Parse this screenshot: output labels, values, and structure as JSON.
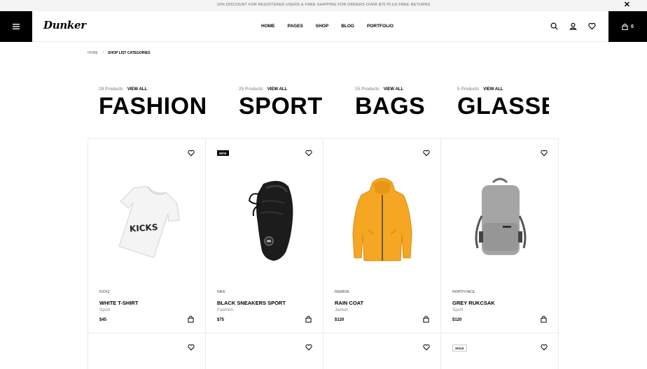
{
  "topbar": {
    "promo": "10% DISCOUNT FOR REGISTERED USERS & FREE SHIPPING FOR ORDERS OVER $70 PLUS FREE RETURNS",
    "close_icon": "close-icon"
  },
  "header": {
    "logo": "Dunker",
    "nav": [
      "HOME",
      "PAGES",
      "SHOP",
      "BLOG",
      "PORTFOLIO"
    ],
    "cart_count": "0",
    "icons": [
      "menu-icon",
      "search-icon",
      "user-icon",
      "heart-icon",
      "cart-icon"
    ]
  },
  "breadcrumb": {
    "home": "HOME",
    "separator": "/",
    "current": "SHOP LIST CATEGORIES"
  },
  "categories": [
    {
      "count": "28 Products",
      "view_all": "VIEW ALL",
      "name": "FASHION"
    },
    {
      "count": "25 Products",
      "view_all": "VIEW ALL",
      "name": "SPORT"
    },
    {
      "count": "15 Products",
      "view_all": "VIEW ALL",
      "name": "BAGS"
    },
    {
      "count": "5 Products",
      "view_all": "VIEW ALL",
      "name": "GLASSES"
    }
  ],
  "products": [
    {
      "brand": "KICKZ",
      "title": "WHITE T-SHIRT",
      "type": "Sport",
      "price": "$45",
      "badge": "",
      "print": "KICKS"
    },
    {
      "brand": "NIKE",
      "title": "BLACK SNEAKERS SPORT",
      "type": "Fashion",
      "price": "$75",
      "badge": "NEW"
    },
    {
      "brand": "REEBOK",
      "title": "RAIN COAT",
      "type": "Jacket",
      "price": "$120",
      "badge": ""
    },
    {
      "brand": "NORTH FACE",
      "title": "GREY RUKCSAK",
      "type": "Sport",
      "price": "$120",
      "badge": ""
    }
  ],
  "second_row_badges": [
    "",
    "",
    "",
    "SOLD"
  ],
  "colors": {
    "accent": "#000000",
    "topbar_bg": "#f3f3f3",
    "border": "#ebebeb",
    "raincoat": "#f5a623",
    "backpack": "#9a9a9a"
  }
}
